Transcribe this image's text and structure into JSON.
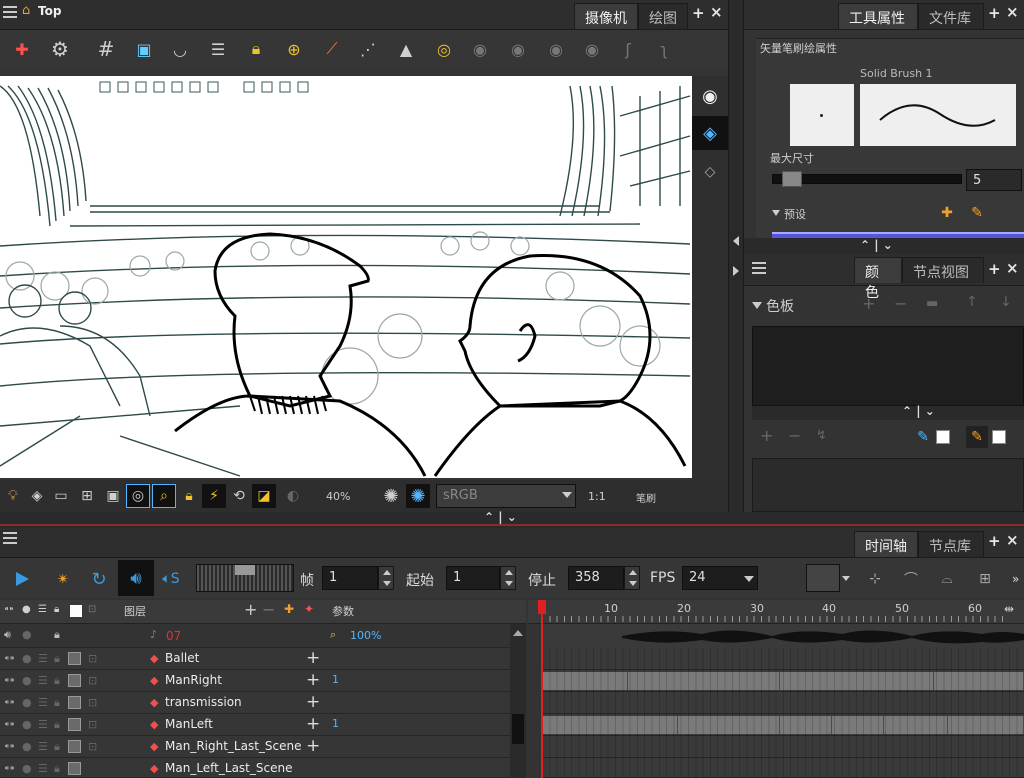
{
  "title_bar": {
    "app_icon": "home-icon",
    "title": "Top"
  },
  "camera_panel": {
    "tabs": [
      {
        "label": "摄像机"
      },
      {
        "label": "绘图"
      }
    ],
    "plus": "+",
    "close": "×",
    "bottom_toolbar": {
      "zoom": "40%",
      "color_space": "sRGB",
      "ratio": "1:1",
      "brush_label": "笔刷"
    }
  },
  "tool_properties": {
    "tabs": [
      {
        "label": "工具属性"
      },
      {
        "label": "文件库"
      }
    ],
    "section_title": "矢量笔刷绘属性",
    "brush_name": "Solid Brush 1",
    "max_size_label": "最大尺寸",
    "max_size_value": "5",
    "max_size_fraction": 0.05,
    "preset_label": "预设"
  },
  "color_panel": {
    "tabs": [
      {
        "label": "颜色"
      },
      {
        "label": "节点视图"
      }
    ],
    "palette_label": "色板"
  },
  "timeline_panel": {
    "tabs": [
      {
        "label": "时间轴"
      },
      {
        "label": "节点库"
      }
    ],
    "frame_label": "帧",
    "frame_value": "1",
    "start_label": "起始",
    "start_value": "1",
    "stop_label": "停止",
    "stop_value": "358",
    "fps_label": "FPS",
    "fps_value": "24",
    "layers_header": "图层",
    "params_header": "参数",
    "ruler": [
      "10",
      "20",
      "30",
      "40",
      "50",
      "60"
    ],
    "sound_name": "07",
    "sound_value": "100%",
    "layers": [
      {
        "name": "Ballet",
        "value": ""
      },
      {
        "name": "ManRight",
        "value": "1"
      },
      {
        "name": "transmission",
        "value": ""
      },
      {
        "name": "ManLeft",
        "value": "1"
      },
      {
        "name": "Man_Right_Last_Scene",
        "value": ""
      },
      {
        "name": "Man_Left_Last_Scene",
        "value": ""
      }
    ]
  },
  "colors": {
    "accent_blue": "#4fb6ff",
    "panel_bg": "#353535",
    "playhead_red": "#e02020"
  }
}
